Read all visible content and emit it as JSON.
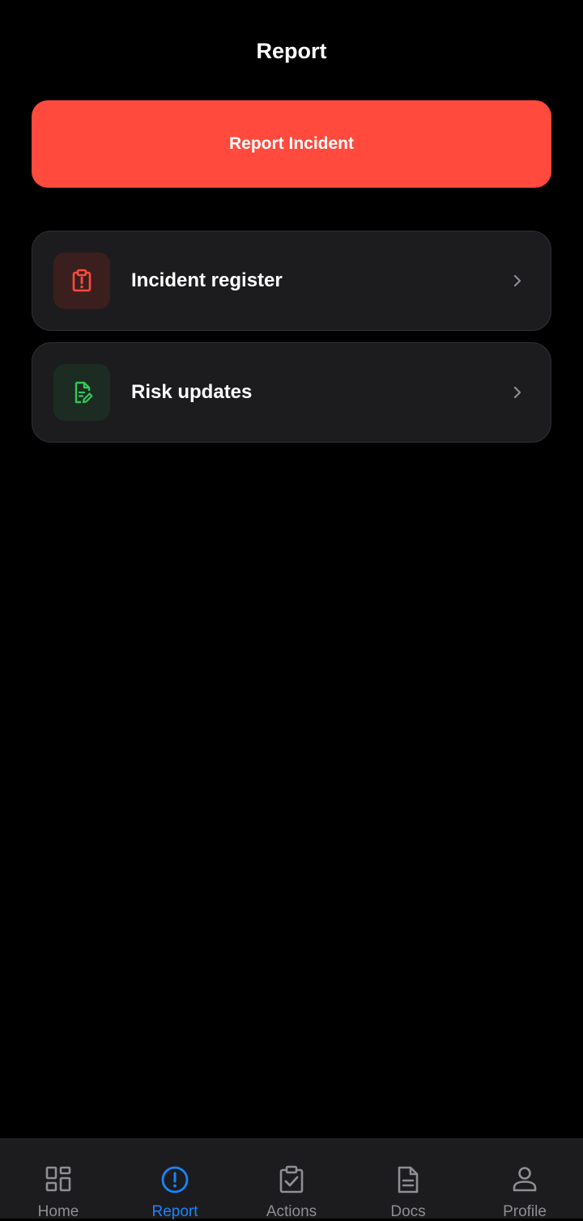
{
  "header": {
    "title": "Report"
  },
  "primary_action": {
    "label": "Report Incident",
    "color": "#ff4a3d"
  },
  "menu": {
    "items": [
      {
        "label": "Incident register",
        "icon": "clipboard-alert-icon",
        "accent": "#ff4a3d"
      },
      {
        "label": "Risk updates",
        "icon": "document-edit-icon",
        "accent": "#34c759"
      }
    ]
  },
  "tab_bar": {
    "active": "Report",
    "active_color": "#1a84ff",
    "tabs": [
      {
        "label": "Home",
        "icon": "dashboard-grid-icon"
      },
      {
        "label": "Report",
        "icon": "alert-circle-icon"
      },
      {
        "label": "Actions",
        "icon": "clipboard-check-icon"
      },
      {
        "label": "Docs",
        "icon": "document-icon"
      },
      {
        "label": "Profile",
        "icon": "person-icon"
      }
    ]
  }
}
